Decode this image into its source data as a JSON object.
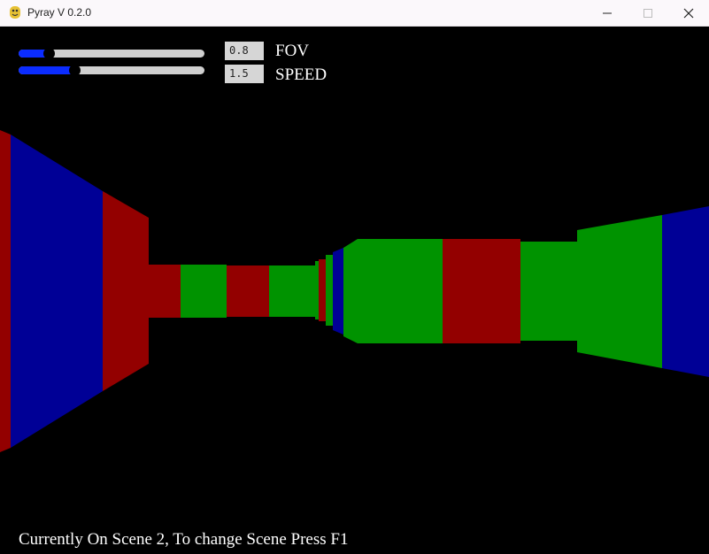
{
  "window": {
    "title": "Pyray V 0.2.0"
  },
  "controls": {
    "fov": {
      "label": "FOV",
      "value": "0.8",
      "level_percent": 16
    },
    "speed": {
      "label": "SPEED",
      "value": "1.5",
      "level_percent": 30
    }
  },
  "footer": {
    "text": "Currently On Scene 2, To change Scene Press F1"
  },
  "colors": {
    "red": "#930000",
    "green": "#009300",
    "blue": "#000096",
    "slider_fill": "#0b2cff",
    "slider_track": "#cfcfcf"
  }
}
